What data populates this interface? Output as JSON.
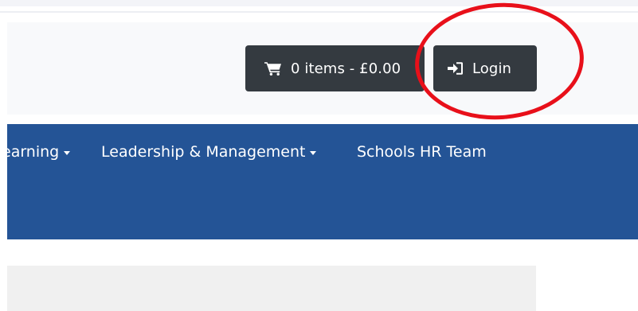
{
  "header": {
    "cart_label": "0 items - £0.00",
    "login_label": "Login",
    "cart_icon": "shopping-cart-icon",
    "login_icon": "sign-in-icon"
  },
  "nav": {
    "items": [
      {
        "label": "earning",
        "has_dropdown": true
      },
      {
        "label": "Leadership & Management",
        "has_dropdown": true
      },
      {
        "label": "Schools HR Team",
        "has_dropdown": false
      }
    ]
  },
  "colors": {
    "navbar_bg": "#245496",
    "button_bg": "#343a40",
    "annotation": "#e8101a",
    "header_bg": "#f8f9fb",
    "content_bg": "#f0f0f0"
  }
}
